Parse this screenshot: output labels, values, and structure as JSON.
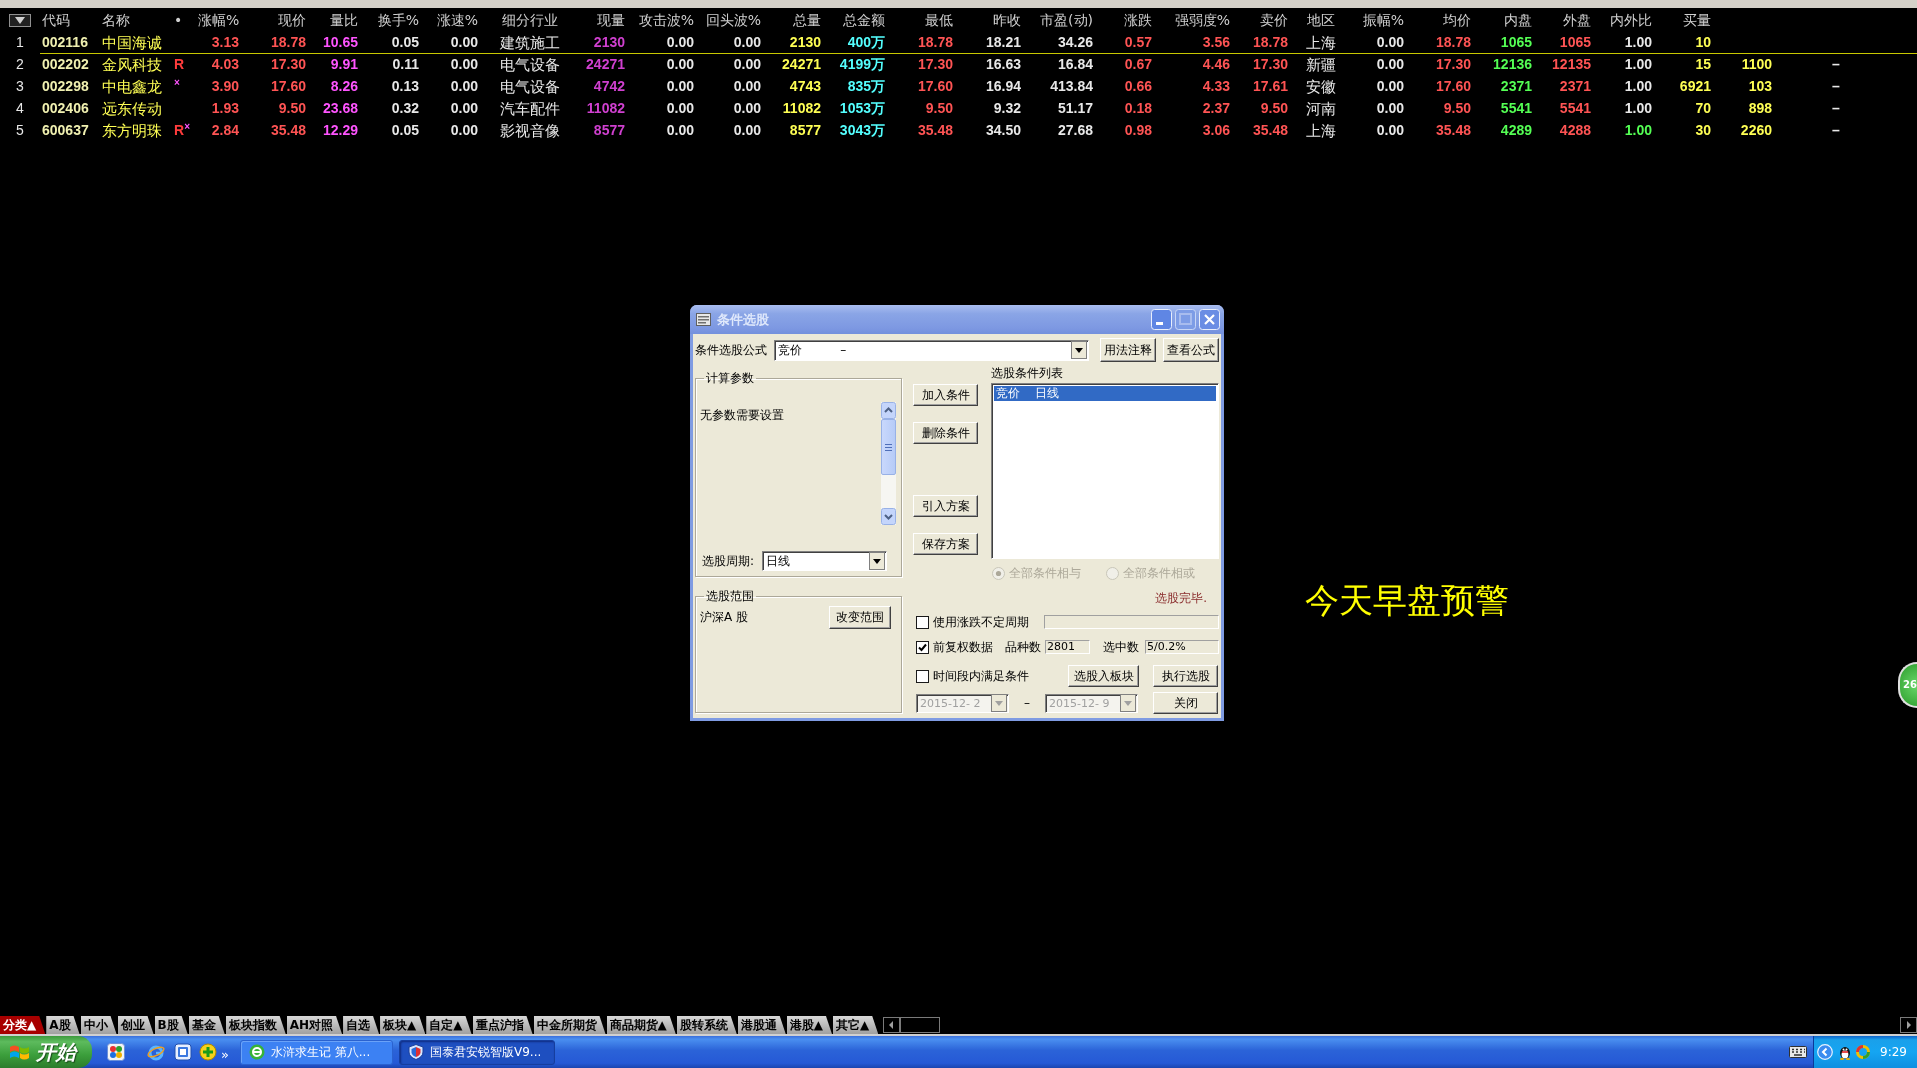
{
  "stock_table": {
    "columns": [
      {
        "label": "代码",
        "color": "#f0f0b0"
      },
      {
        "label": "名称",
        "color": "#ffff54"
      },
      {
        "label": "•",
        "color": "#ff3c3c"
      },
      {
        "label": "涨幅%",
        "color": "#ff5454"
      },
      {
        "label": "现价",
        "color": "#ff5454"
      },
      {
        "label": "量比",
        "color": "#ff54ff"
      },
      {
        "label": "换手%",
        "color": "#e8e8e8"
      },
      {
        "label": "涨速%",
        "color": "#e8e8e8"
      },
      {
        "label": "细分行业",
        "color": "#e8e8e8"
      },
      {
        "label": "现量",
        "color": "#d040d0"
      },
      {
        "label": "攻击波%",
        "color": "#e8e8e8"
      },
      {
        "label": "回头波%",
        "color": "#e8e8e8"
      },
      {
        "label": "总量",
        "color": "#ffff54"
      },
      {
        "label": "总金额",
        "color": "#54ffff"
      },
      {
        "label": "最低",
        "color": "#ff5454"
      },
      {
        "label": "昨收",
        "color": "#e8e8e8"
      },
      {
        "label": "市盈(动)",
        "color": "#e8e8e8"
      },
      {
        "label": "涨跌",
        "color": "#ff5454"
      },
      {
        "label": "强弱度%",
        "color": "#ff5454"
      },
      {
        "label": "卖价",
        "color": "#ff5454"
      },
      {
        "label": "地区",
        "color": "#e8e8e8"
      },
      {
        "label": "振幅%",
        "color": "#e8e8e8"
      },
      {
        "label": "均价",
        "color": "#ff5454"
      },
      {
        "label": "内盘",
        "color": "#54ff54"
      },
      {
        "label": "外盘",
        "color": "#ff5454"
      },
      {
        "label": "内外比",
        "color": "#e8e8e8"
      },
      {
        "label": "买量",
        "color": "#ffff54"
      },
      {
        "color": "#ffff54"
      },
      {
        "color": "#e8e8e8"
      }
    ],
    "rows": [
      {
        "index": "1",
        "selected": true,
        "cells": [
          "002116",
          "中国海诚",
          null,
          "3.13",
          "18.78",
          "10.65",
          "0.05",
          "0.00",
          "建筑施工",
          "2130",
          "0.00",
          "0.00",
          "2130",
          "400万",
          "18.78",
          "18.21",
          "34.26",
          "0.57",
          "3.56",
          "18.78",
          "上海",
          "0.00",
          "18.78",
          "1065",
          "1065",
          "1.00",
          "10"
        ]
      },
      {
        "index": "2",
        "selected": false,
        "cells": [
          "002202",
          "金风科技",
          "R",
          "4.03",
          "17.30",
          "9.91",
          "0.11",
          "0.00",
          "电气设备",
          "24271",
          "0.00",
          "0.00",
          "24271",
          "4199万",
          "17.30",
          "16.63",
          "16.84",
          "0.67",
          "4.46",
          "17.30",
          "新疆",
          "0.00",
          "17.30",
          "12136",
          "12135",
          "1.00",
          "15",
          "1100",
          "–"
        ]
      },
      {
        "index": "3",
        "selected": false,
        "cells": [
          "002298",
          "中电鑫龙",
          "$^{×}$",
          "3.90",
          "17.60",
          "8.26",
          "0.13",
          "0.00",
          "电气设备",
          "4742",
          "0.00",
          "0.00",
          "4743",
          "835万",
          "17.60",
          "16.94",
          "413.84",
          "0.66",
          "4.33",
          "17.61",
          "安徽",
          "0.00",
          "17.60",
          "2371",
          "2371",
          "1.00",
          "6921",
          "103",
          "–"
        ]
      },
      {
        "index": "4",
        "selected": false,
        "cells": [
          "002406",
          "远东传动",
          null,
          "1.93",
          "9.50",
          "23.68",
          "0.32",
          "0.00",
          "汽车配件",
          "11082",
          "0.00",
          "0.00",
          "11082",
          "1053万",
          "9.50",
          "9.32",
          "51.17",
          "0.18",
          "2.37",
          "9.50",
          "河南",
          "0.00",
          "9.50",
          "5541",
          "5541",
          "1.00",
          "70",
          "898",
          "–"
        ]
      },
      {
        "index": "5",
        "selected": false,
        "cells": [
          "600637",
          "东方明珠",
          "R$^{×}$",
          "2.84",
          "35.48",
          "12.29",
          "0.05",
          "0.00",
          "影视音像",
          "8577",
          "0.00",
          "0.00",
          "8577",
          "3043万",
          "35.48",
          "34.50",
          "27.68",
          "0.98",
          "3.06",
          "35.48",
          "上海",
          "0.00",
          "35.48",
          "4289",
          "4288",
          {
            "text": "1.00",
            "color": "#54ff54"
          },
          "30",
          "2260",
          "–"
        ]
      }
    ]
  },
  "alert_text": "今天早盘预警",
  "side_badge": "26",
  "dialog": {
    "title": "条件选股",
    "formula": {
      "label": "条件选股公式",
      "value": "竞价          –"
    },
    "header_buttons": [
      "用法注释",
      "查看公式"
    ],
    "params_group": {
      "title": "计算参数",
      "message": "无参数需要设置",
      "period_label": "选股周期:",
      "period_value": "日线"
    },
    "range_group": {
      "title": "选股范围",
      "value": "沪深A 股",
      "button": "改变范围"
    },
    "middle_buttons": [
      "加入条件",
      "删除条件",
      "引入方案",
      "保存方案"
    ],
    "condition_list": {
      "label": "选股条件列表",
      "items": [
        {
          "text": "竞价    日线",
          "selected": true
        }
      ]
    },
    "combine_options": [
      {
        "label": "全部条件相与",
        "selected": true,
        "disabled": true
      },
      {
        "label": "全部条件相或",
        "selected": false,
        "disabled": true
      }
    ],
    "status": "选股完毕.",
    "period_option": {
      "label": "使用涨跌不定周期",
      "checked": false
    },
    "adjust_option": {
      "label": "前复权数据",
      "checked": true
    },
    "count_label": "品种数",
    "count_value": "2801",
    "selected_label": "选中数",
    "selected_value": "5/0.2%",
    "range_option": {
      "label": "时间段内满足条件",
      "checked": false
    },
    "to_block_button": "选股入板块",
    "run_button": "执行选股",
    "dates": {
      "from": "2015-12- 2",
      "separator": "–",
      "to": "2015-12- 9",
      "disabled": true
    },
    "close_button": "关闭"
  },
  "category_tabs": [
    {
      "label": "分类▲",
      "selected": true
    },
    {
      "label": "A股",
      "selected": false
    },
    {
      "label": "中小",
      "selected": false
    },
    {
      "label": "创业",
      "selected": false
    },
    {
      "label": "B股",
      "selected": false
    },
    {
      "label": "基金",
      "selected": false
    },
    {
      "label": "板块指数",
      "selected": false
    },
    {
      "label": "AH对照",
      "selected": false
    },
    {
      "label": "自选",
      "selected": false
    },
    {
      "label": "板块▲",
      "selected": false
    },
    {
      "label": "自定▲",
      "selected": false
    },
    {
      "label": "重点沪指",
      "selected": false
    },
    {
      "label": "中金所期货",
      "selected": false
    },
    {
      "label": "商品期货▲",
      "selected": false
    },
    {
      "label": "股转系统",
      "selected": false
    },
    {
      "label": "港股通",
      "selected": false
    },
    {
      "label": "港股▲",
      "selected": false
    },
    {
      "label": "其它▲",
      "selected": false
    }
  ],
  "taskbar": {
    "start": "开始",
    "quick_launch_more": "»",
    "tasks": [
      {
        "label": "水浒求生记 第八...",
        "selected": false
      },
      {
        "label": "国泰君安锐智版V9...",
        "selected": true
      }
    ],
    "clock": "9:29"
  }
}
